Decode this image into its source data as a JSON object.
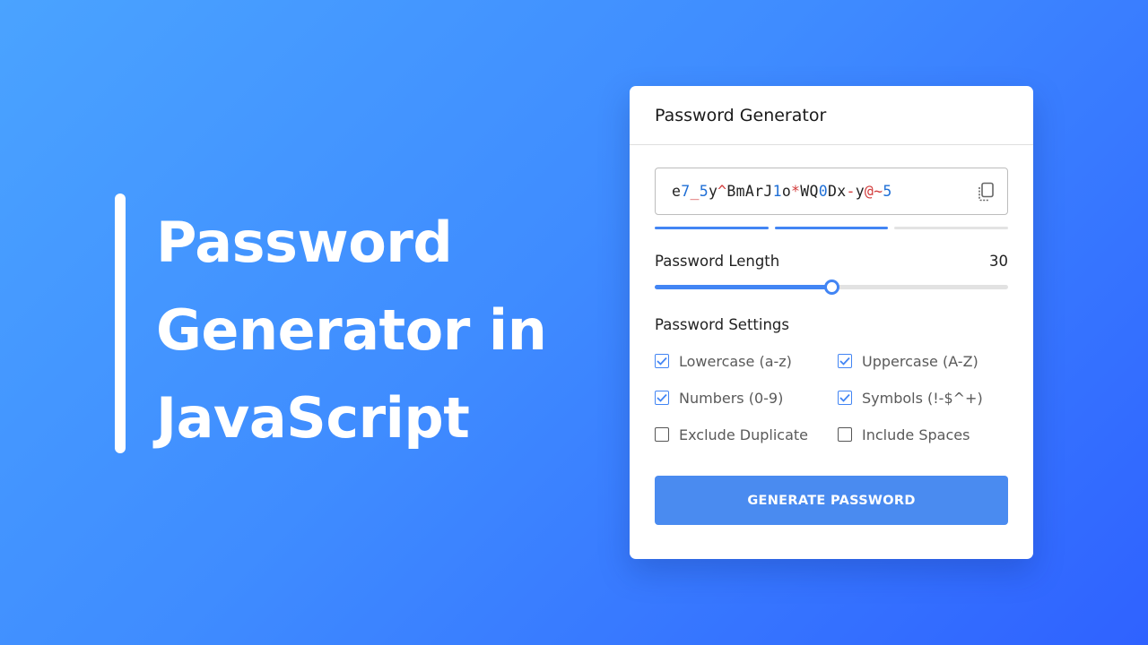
{
  "hero": {
    "line1": "Password",
    "line2": "Generator in",
    "line3": "JavaScript"
  },
  "card": {
    "title": "Password Generator",
    "password": {
      "value": "e7_5y^BmArJ1o*WQ0Dx-y@~5",
      "copy_icon": "copy-icon"
    },
    "strength": {
      "segments_total": 3,
      "segments_filled": 2,
      "color_filled": "#4285f4",
      "color_empty": "#e3e3e3"
    },
    "length": {
      "label": "Password Length",
      "value": "30",
      "fraction": 0.5
    },
    "settings": {
      "label": "Password Settings",
      "options": [
        {
          "label": "Lowercase (a-z)",
          "checked": true
        },
        {
          "label": "Uppercase (A-Z)",
          "checked": true
        },
        {
          "label": "Numbers (0-9)",
          "checked": true
        },
        {
          "label": "Symbols (!-$^+)",
          "checked": true
        },
        {
          "label": "Exclude Duplicate",
          "checked": false
        },
        {
          "label": "Include Spaces",
          "checked": false
        }
      ]
    },
    "generate_label": "GENERATE PASSWORD",
    "accent": "#4285f4"
  }
}
